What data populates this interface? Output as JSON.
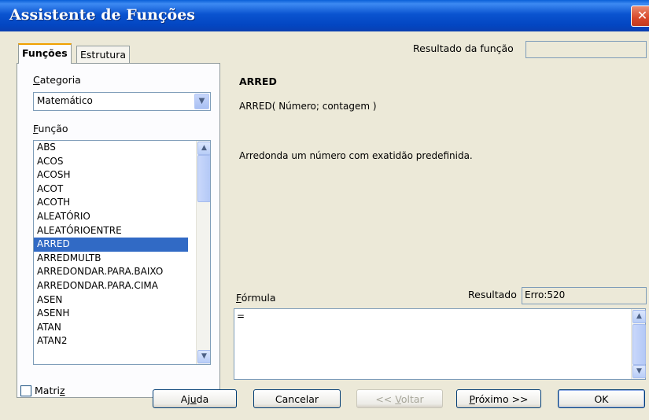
{
  "window": {
    "title": "Assistente de Funções"
  },
  "tabs": [
    {
      "label": "Funções"
    },
    {
      "label": "Estrutura"
    }
  ],
  "category": {
    "label": "Categoria",
    "value": "Matemático"
  },
  "function_list": {
    "label": "Função",
    "items": [
      "ABS",
      "ACOS",
      "ACOSH",
      "ACOT",
      "ACOTH",
      "ALEATÓRIO",
      "ALEATÓRIOENTRE",
      "ARRED",
      "ARREDMULTB",
      "ARREDONDAR.PARA.BAIXO",
      "ARREDONDAR.PARA.CIMA",
      "ASEN",
      "ASENH",
      "ATAN",
      "ATAN2"
    ],
    "selected": "ARRED"
  },
  "function_result": {
    "label": "Resultado da função",
    "value": ""
  },
  "detail": {
    "name": "ARRED",
    "syntax": "ARRED( Número; contagem )",
    "description": "Arredonda um número com exatidão predefinida."
  },
  "result": {
    "label": "Resultado",
    "value": "Erro:520"
  },
  "formula": {
    "label": "Fórmula",
    "value": "="
  },
  "matrix": {
    "label": "Matriz",
    "checked": false
  },
  "buttons": {
    "help": "Ajuda",
    "cancel": "Cancelar",
    "back": "<< Voltar",
    "next": "Próximo >>",
    "ok": "OK"
  },
  "icons": {
    "close": "close-icon",
    "dropdown": "chevron-down-icon",
    "scroll_up": "chevron-up-icon",
    "scroll_down": "chevron-down-icon"
  }
}
